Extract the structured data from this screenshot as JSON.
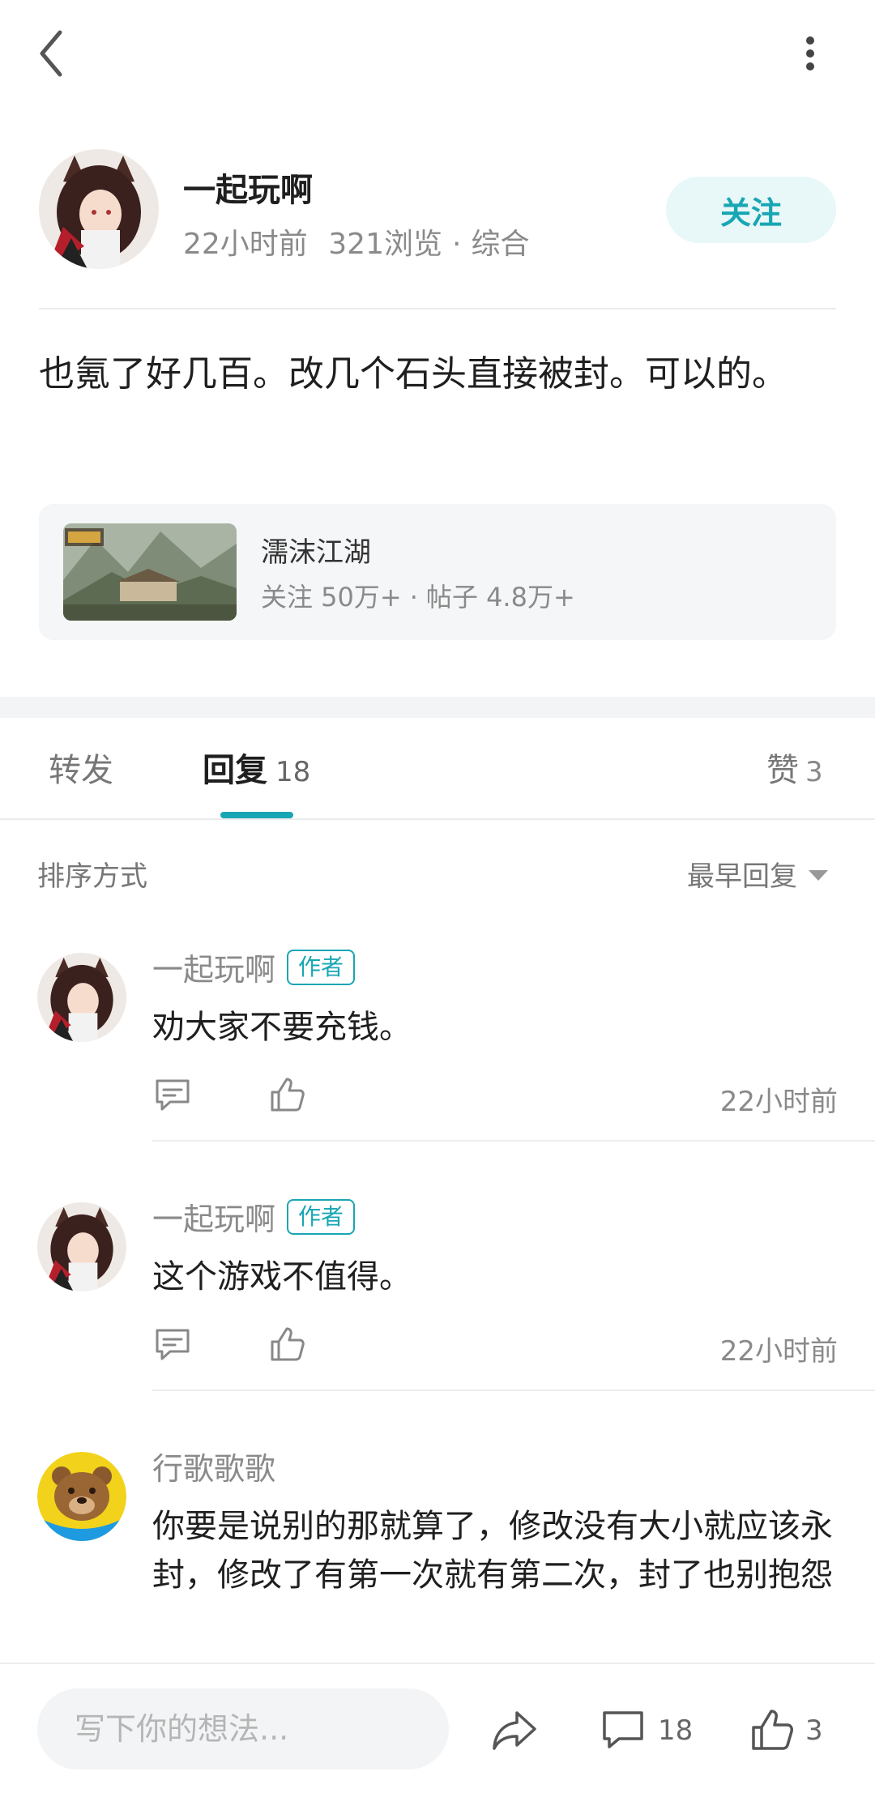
{
  "header": {
    "back_icon": "chevron-left-icon",
    "more_icon": "more-vertical-icon"
  },
  "post": {
    "author": "一起玩啊",
    "time": "22小时前",
    "views": "321浏览",
    "meta_separator": "·",
    "category": "综合",
    "follow_label": "关注",
    "content": "也氪了好几百。改几个石头直接被封。可以的。"
  },
  "game_card": {
    "title": "濡沫江湖",
    "followers_label": "关注 50万+",
    "separator": "·",
    "posts_label": "帖子 4.8万+"
  },
  "tabs": {
    "repost_label": "转发",
    "reply_label": "回复",
    "reply_count": "18",
    "like_label": "赞",
    "like_count": "3"
  },
  "sort": {
    "label": "排序方式",
    "selected": "最早回复"
  },
  "comments": [
    {
      "author": "一起玩啊",
      "tag": "作者",
      "text": "劝大家不要充钱。",
      "time": "22小时前"
    },
    {
      "author": "一起玩啊",
      "tag": "作者",
      "text": "这个游戏不值得。",
      "time": "22小时前"
    },
    {
      "author": "行歌歌歌",
      "text": "你要是说别的那就算了，修改没有大小就应该永封，修改了有第一次就有第二次，封了也别抱怨"
    }
  ],
  "bottom_bar": {
    "input_placeholder": "写下你的想法...",
    "comment_count": "18",
    "like_count": "3"
  },
  "colors": {
    "accent": "#18a6b4",
    "follow_bg": "#e8f7f8",
    "muted_text": "#8a8a8a",
    "card_bg": "#f5f6f7"
  }
}
